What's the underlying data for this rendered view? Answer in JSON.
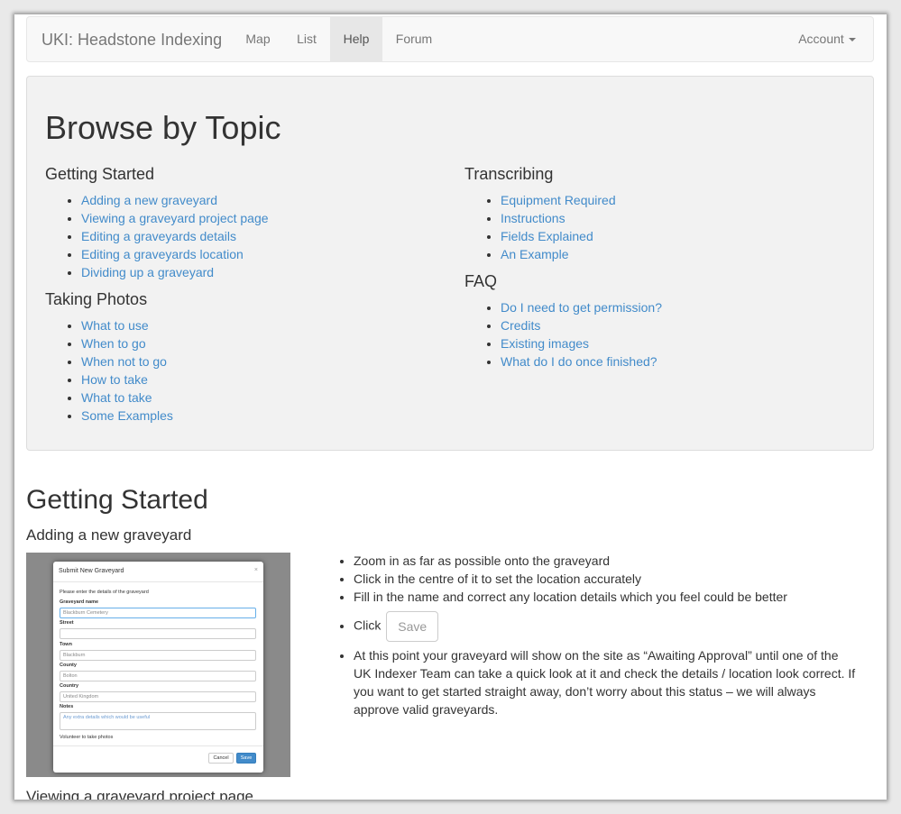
{
  "navbar": {
    "brand": "UKI: Headstone Indexing",
    "items": [
      {
        "label": "Map"
      },
      {
        "label": "List"
      },
      {
        "label": "Help"
      },
      {
        "label": "Forum"
      }
    ],
    "active": "Help",
    "account_label": "Account"
  },
  "browse": {
    "title": "Browse by Topic",
    "getting_started": {
      "heading": "Getting Started",
      "links": [
        "Adding a new graveyard",
        "Viewing a graveyard project page",
        "Editing a graveyards details",
        "Editing a graveyards location",
        "Dividing up a graveyard"
      ]
    },
    "taking_photos": {
      "heading": "Taking Photos",
      "links": [
        "What to use",
        "When to go",
        "When not to go",
        "How to take",
        "What to take",
        "Some Examples"
      ]
    },
    "transcribing": {
      "heading": "Transcribing",
      "links": [
        "Equipment Required",
        "Instructions",
        "Fields Explained",
        "An Example"
      ]
    },
    "faq": {
      "heading": "FAQ",
      "links": [
        "Do I need to get permission?",
        "Credits",
        "Existing images",
        "What do I do once finished?"
      ]
    }
  },
  "content": {
    "section_title": "Getting Started",
    "sub1_title": "Adding a new graveyard",
    "sub2_title": "Viewing a graveyard project page",
    "steps": {
      "s1": "Zoom in as far as possible onto the graveyard",
      "s2": "Click in the centre of it to set the location accurately",
      "s3": "Fill in the name and correct any location details which you feel could be better",
      "s4_prefix": "Click",
      "save_label": "Save",
      "s5": "At this point your graveyard will show on the site as “Awaiting Approval” until one of the UK Indexer Team can take a quick look at it and check the details / location look correct. If you want to get started straight away, don’t worry about this status – we will always approve valid graveyards."
    },
    "screenshot": {
      "modal_title": "Submit New Graveyard",
      "intro": "Please enter the details of the graveyard",
      "fields": {
        "name_label": "Graveyard name",
        "name_value": "Blackburn Cemetery",
        "street_label": "Street",
        "town_label": "Town",
        "town_value": "Blackburn",
        "county_label": "County",
        "county_value": "Bolton",
        "country_label": "Country",
        "country_value": "United Kingdom",
        "notes_label": "Notes",
        "notes_value": "Any extra details which would be useful",
        "checkbox_label": "Volunteer to take photos"
      },
      "cancel_label": "Cancel",
      "save_label": "Save"
    }
  },
  "colors": {
    "link": "#428bca",
    "navbar_bg": "#f8f8f8",
    "jumbotron_bg": "#f2f2f2"
  }
}
